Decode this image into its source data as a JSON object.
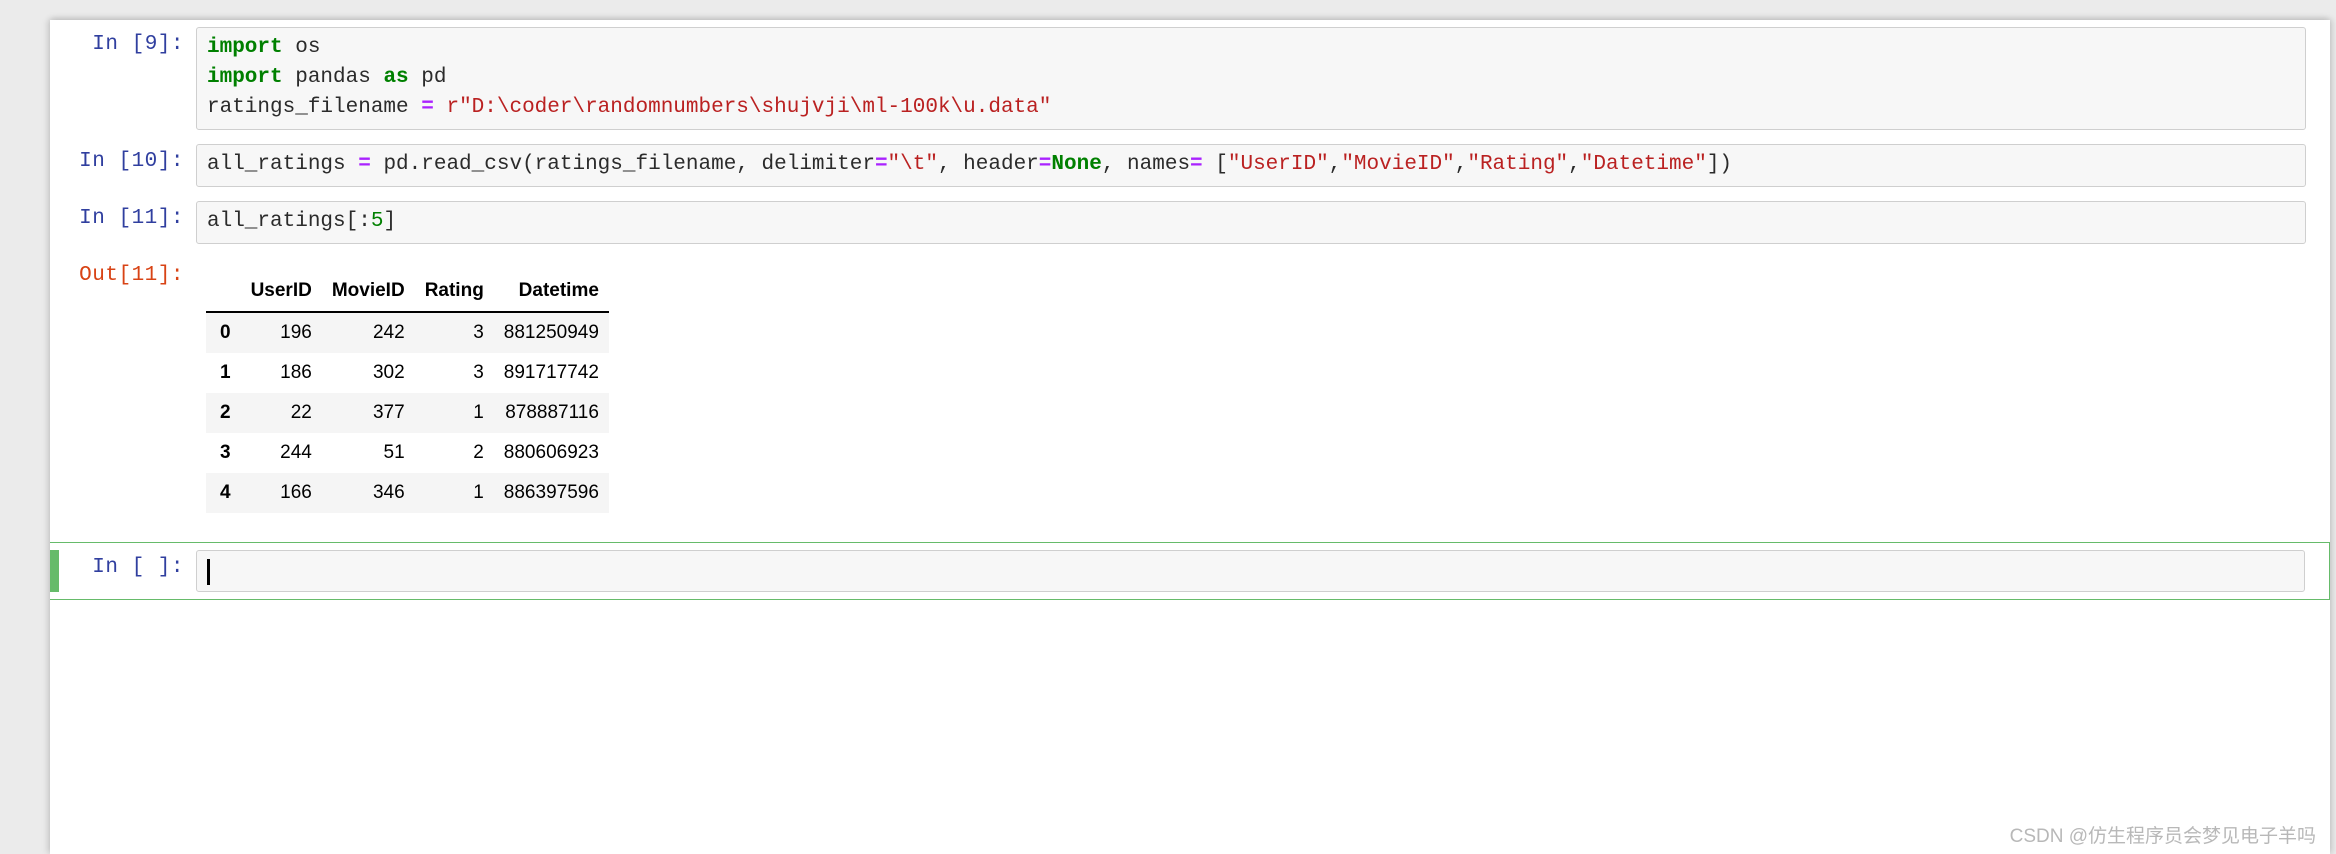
{
  "page": {
    "background_color": "#ebebeb",
    "surface_color": "#ffffff"
  },
  "colors": {
    "in_prompt": "#303f9f",
    "out_prompt": "#d84315",
    "selected_cell_accent": "#66bb6a",
    "code_background": "#f7f7f7",
    "code_border": "#cfcfcf",
    "keyword": "#008000",
    "string": "#ba2121",
    "operator": "#aa22ff",
    "table_stripe": "#f5f5f5"
  },
  "cells": [
    {
      "prompt": "In [9]:",
      "type": "code",
      "lines": [
        [
          {
            "t": "import",
            "c": "kw"
          },
          {
            "t": " os",
            "c": "pl"
          }
        ],
        [
          {
            "t": "import",
            "c": "kw"
          },
          {
            "t": " pandas ",
            "c": "pl"
          },
          {
            "t": "as",
            "c": "kw"
          },
          {
            "t": " pd",
            "c": "pl"
          }
        ],
        [
          {
            "t": "ratings_filename ",
            "c": "pl"
          },
          {
            "t": "=",
            "c": "op"
          },
          {
            "t": " r\"D:\\coder\\randomnumbers\\shujvji\\ml-100k\\u.data\"",
            "c": "str"
          }
        ]
      ]
    },
    {
      "prompt": "In [10]:",
      "type": "code",
      "lines": [
        [
          {
            "t": "all_ratings ",
            "c": "pl"
          },
          {
            "t": "=",
            "c": "op"
          },
          {
            "t": " pd.read_csv(ratings_filename, delimiter",
            "c": "pl"
          },
          {
            "t": "=",
            "c": "op"
          },
          {
            "t": "\"\\t\"",
            "c": "str"
          },
          {
            "t": ", header",
            "c": "pl"
          },
          {
            "t": "=",
            "c": "op"
          },
          {
            "t": "None",
            "c": "kw"
          },
          {
            "t": ", names",
            "c": "pl"
          },
          {
            "t": "=",
            "c": "op"
          },
          {
            "t": " [",
            "c": "pl"
          },
          {
            "t": "\"UserID\"",
            "c": "str"
          },
          {
            "t": ",",
            "c": "pl"
          },
          {
            "t": "\"MovieID\"",
            "c": "str"
          },
          {
            "t": ",",
            "c": "pl"
          },
          {
            "t": "\"Rating\"",
            "c": "str"
          },
          {
            "t": ",",
            "c": "pl"
          },
          {
            "t": "\"Datetime\"",
            "c": "str"
          },
          {
            "t": "])",
            "c": "pl"
          }
        ]
      ]
    },
    {
      "prompt": "In [11]:",
      "type": "code",
      "lines": [
        [
          {
            "t": "all_ratings[:",
            "c": "pl"
          },
          {
            "t": "5",
            "c": "num"
          },
          {
            "t": "]",
            "c": "pl"
          }
        ]
      ]
    }
  ],
  "output": {
    "prompt": "Out[11]:",
    "table": {
      "index_header": "",
      "columns": [
        "UserID",
        "MovieID",
        "Rating",
        "Datetime"
      ],
      "index": [
        "0",
        "1",
        "2",
        "3",
        "4"
      ],
      "rows": [
        [
          "196",
          "242",
          "3",
          "881250949"
        ],
        [
          "186",
          "302",
          "3",
          "891717742"
        ],
        [
          "22",
          "377",
          "1",
          "878887116"
        ],
        [
          "244",
          "51",
          "2",
          "880606923"
        ],
        [
          "166",
          "346",
          "1",
          "886397596"
        ]
      ]
    }
  },
  "active_cell": {
    "prompt": "In [ ]:",
    "value": "",
    "placeholder": "",
    "selected": true,
    "editing": true
  },
  "watermark": {
    "text": "CSDN @仿生程序员会梦见电子羊吗"
  }
}
